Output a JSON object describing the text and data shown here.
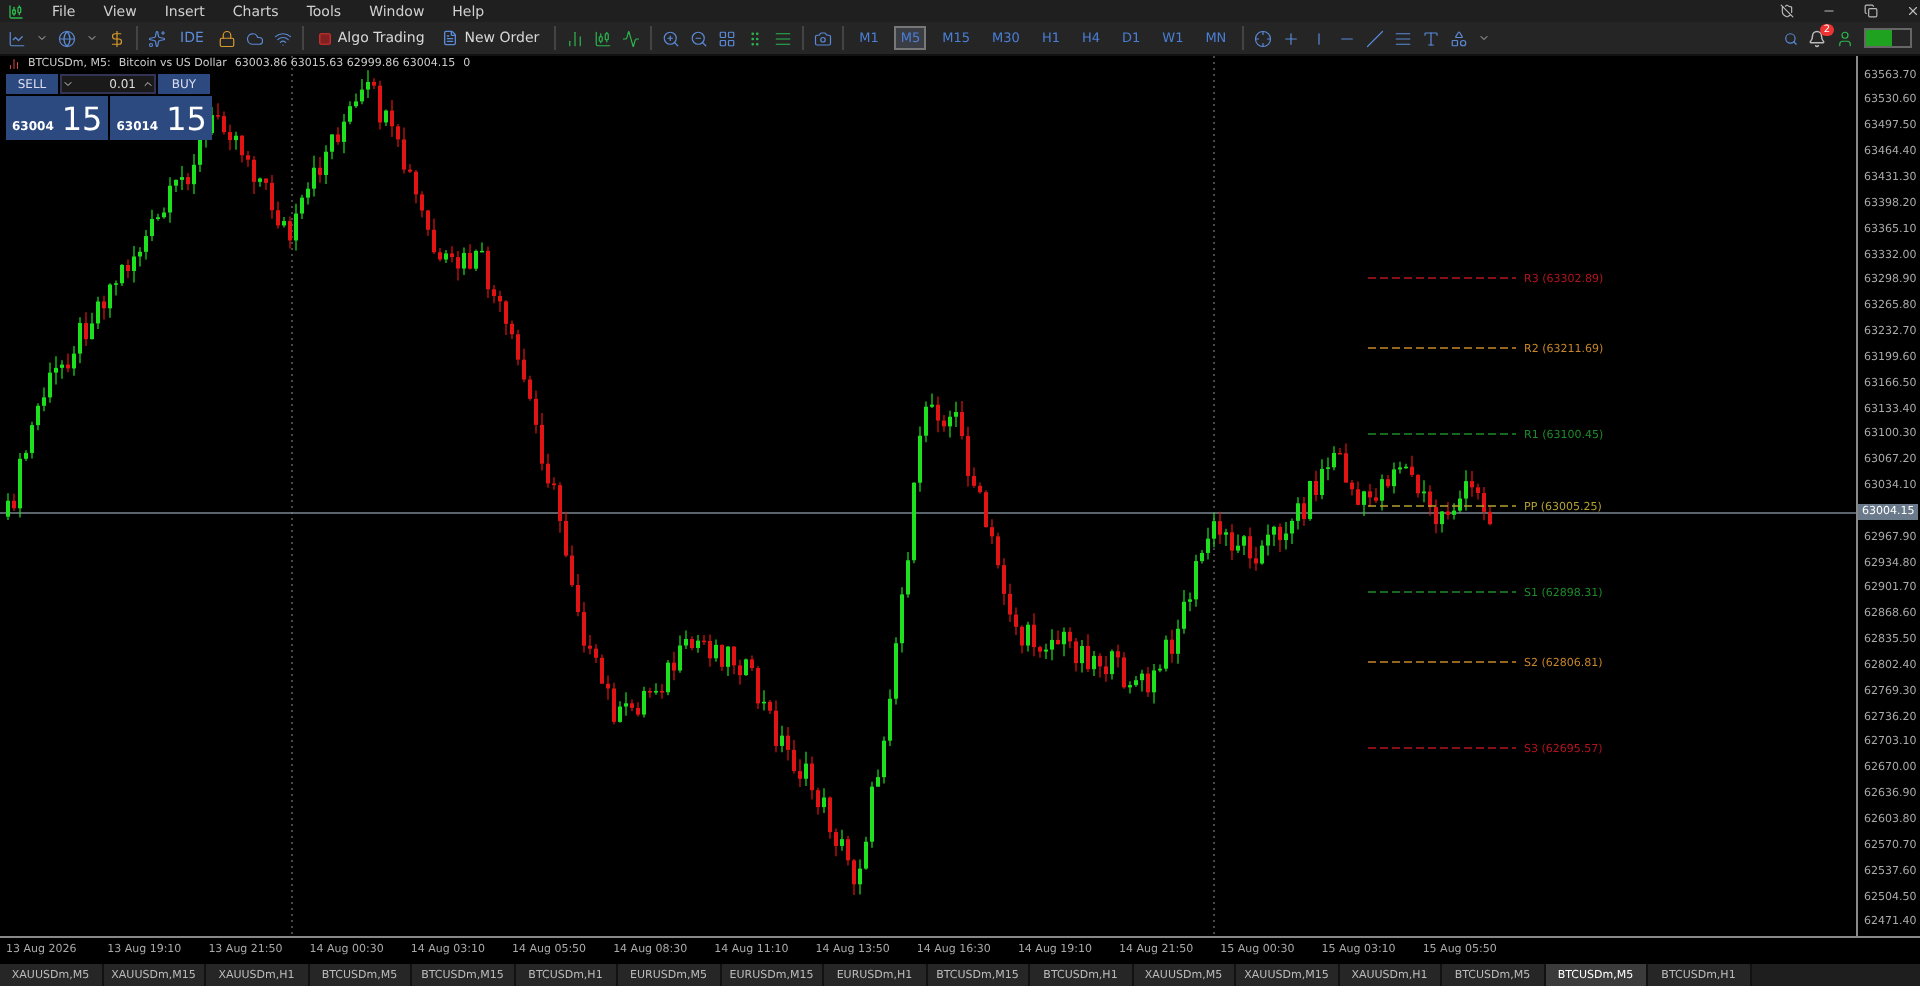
{
  "menu": [
    "File",
    "View",
    "Insert",
    "Charts",
    "Tools",
    "Window",
    "Help"
  ],
  "toolbar": {
    "ide": "IDE",
    "algo_trading": "Algo Trading",
    "new_order": "New Order",
    "notifications": "2",
    "timeframes": [
      {
        "label": "M1",
        "selected": false
      },
      {
        "label": "M5",
        "selected": true
      },
      {
        "label": "M15",
        "selected": false
      },
      {
        "label": "M30",
        "selected": false
      },
      {
        "label": "H1",
        "selected": false
      },
      {
        "label": "H4",
        "selected": false
      },
      {
        "label": "D1",
        "selected": false
      },
      {
        "label": "W1",
        "selected": false
      },
      {
        "label": "MN",
        "selected": false
      }
    ]
  },
  "chart": {
    "symbol": "BTCUSDm, M5:",
    "description": "Bitcoin vs US Dollar",
    "ohlc": "63003.86 63015.63 62999.86 63004.15",
    "volume": "0",
    "trade_panel": {
      "sell": "SELL",
      "buy": "BUY",
      "lot": "0.01",
      "bid_main": "63004",
      "bid_big": "15",
      "ask_main": "63014",
      "ask_big": "15"
    },
    "pivots": [
      {
        "label": "R3 (63302.89)",
        "color": "#b4141e"
      },
      {
        "label": "R2 (63211.69)",
        "color": "#c8862a"
      },
      {
        "label": "R1 (63100.45)",
        "color": "#1e8c2a"
      },
      {
        "label": "PP (63005.25)",
        "color": "#b4a032"
      },
      {
        "label": "S1 (62898.31)",
        "color": "#1e8c2a"
      },
      {
        "label": "S2 (62806.81)",
        "color": "#c8862a"
      },
      {
        "label": "S3 (62695.57)",
        "color": "#b4141e"
      }
    ],
    "price_labels": [
      "63563.70",
      "63530.60",
      "63497.50",
      "63464.40",
      "63431.30",
      "63398.20",
      "63365.10",
      "63332.00",
      "63298.90",
      "63265.80",
      "63232.70",
      "63199.60",
      "63166.50",
      "63133.40",
      "63100.30",
      "63067.20",
      "63034.10",
      "62967.90",
      "62934.80",
      "62901.70",
      "62868.60",
      "62835.50",
      "62802.40",
      "62769.30",
      "62736.20",
      "62703.10",
      "62670.00",
      "62636.90",
      "62603.80",
      "62570.70",
      "62537.60",
      "62504.50",
      "62471.40"
    ],
    "current_price": "63004.15",
    "time_labels": [
      "13 Aug 2026",
      "13 Aug 19:10",
      "13 Aug 21:50",
      "14 Aug 00:30",
      "14 Aug 03:10",
      "14 Aug 05:50",
      "14 Aug 08:30",
      "14 Aug 11:10",
      "14 Aug 13:50",
      "14 Aug 16:30",
      "14 Aug 19:10",
      "14 Aug 21:50",
      "15 Aug 00:30",
      "15 Aug 03:10",
      "15 Aug 05:50"
    ]
  },
  "tabs": [
    {
      "label": "XAUUSDm,M5",
      "selected": false
    },
    {
      "label": "XAUUSDm,M15",
      "selected": false
    },
    {
      "label": "XAUUSDm,H1",
      "selected": false
    },
    {
      "label": "BTCUSDm,M5",
      "selected": false
    },
    {
      "label": "BTCUSDm,M15",
      "selected": false
    },
    {
      "label": "BTCUSDm,H1",
      "selected": false
    },
    {
      "label": "EURUSDm,M5",
      "selected": false
    },
    {
      "label": "EURUSDm,M15",
      "selected": false
    },
    {
      "label": "EURUSDm,H1",
      "selected": false
    },
    {
      "label": "BTCUSDm,M15",
      "selected": false
    },
    {
      "label": "BTCUSDm,H1",
      "selected": false
    },
    {
      "label": "XAUUSDm,M5",
      "selected": false
    },
    {
      "label": "XAUUSDm,M15",
      "selected": false
    },
    {
      "label": "XAUUSDm,H1",
      "selected": false
    },
    {
      "label": "BTCUSDm,M5",
      "selected": false
    },
    {
      "label": "BTCUSDm,M5",
      "selected": true
    },
    {
      "label": "BTCUSDm,H1",
      "selected": false
    }
  ]
}
